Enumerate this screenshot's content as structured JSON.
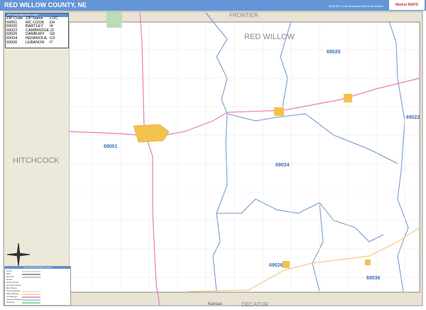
{
  "title": "RED WILLOW COUNTY, NE",
  "edition": "2026 ZIP Code Business Reference Edition",
  "logo": "Market MAPS",
  "locator": {
    "heading": "ZIP Code Index/Grid Locator",
    "headers": [
      "ZIP Code",
      "ZIP Name",
      "LOC"
    ],
    "rows": [
      [
        "69001",
        "MC COOK",
        "D4"
      ],
      [
        "69020",
        "BARTLEY",
        "I4"
      ],
      [
        "69022",
        "CAMBRIDGE",
        "J3"
      ],
      [
        "69026",
        "DANBURY",
        "G6"
      ],
      [
        "69034",
        "INDIANOLA",
        "G3"
      ],
      [
        "69036",
        "LEBANON",
        "I7"
      ]
    ]
  },
  "legend": {
    "heading": "Map Legend & Population Symbols",
    "items": [
      "County",
      "State",
      "ZIP Code",
      "Streets",
      "Primary Streets",
      "Secondary Streets",
      "Minor Streets",
      "County Highways",
      "State Highways",
      "US Highways",
      "Interstate Highways",
      "Toll Roads"
    ]
  },
  "labels": {
    "county": "RED WILLOW",
    "frontier": "FRONTIER",
    "hitchcock": "HITCHCOCK",
    "decatur": "DECATUR",
    "kansas": "Kansas"
  },
  "zips": [
    "69020",
    "69022",
    "69001",
    "69034",
    "69026",
    "69036"
  ],
  "colors": {
    "zip_boundary": "#6b93c8",
    "us_highway": "#f07ab8",
    "state_highway": "#f7c88a",
    "town": "#f2c24c",
    "title_bar": "#6495d6"
  }
}
